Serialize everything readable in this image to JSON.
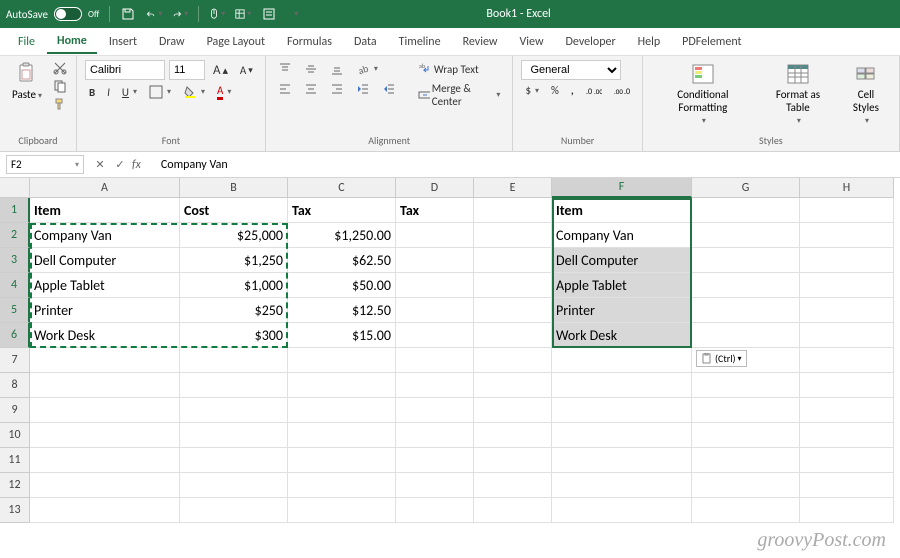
{
  "titlebar": {
    "autosave": "AutoSave",
    "autosave_state": "Off",
    "title": "Book1 - Excel"
  },
  "menu": {
    "file": "File",
    "home": "Home",
    "insert": "Insert",
    "draw": "Draw",
    "page_layout": "Page Layout",
    "formulas": "Formulas",
    "data": "Data",
    "timeline": "Timeline",
    "review": "Review",
    "view": "View",
    "developer": "Developer",
    "help": "Help",
    "pdf": "PDFelement"
  },
  "ribbon": {
    "clipboard": {
      "paste": "Paste",
      "label": "Clipboard"
    },
    "font": {
      "name": "Calibri",
      "size": "11",
      "label": "Font"
    },
    "alignment": {
      "wrap": "Wrap Text",
      "merge": "Merge & Center",
      "label": "Alignment"
    },
    "number": {
      "format": "General",
      "label": "Number"
    },
    "styles": {
      "cond": "Conditional Formatting",
      "table": "Format as Table",
      "cell": "Cell Styles",
      "label": "Styles"
    }
  },
  "formulabar": {
    "ref": "F2",
    "value": "Company Van"
  },
  "columns": [
    "A",
    "B",
    "C",
    "D",
    "E",
    "F",
    "G",
    "H"
  ],
  "grid": {
    "headers": {
      "A": "Item",
      "B": "Cost",
      "C": "Tax",
      "D": "Tax",
      "F": "Item"
    },
    "rows": [
      {
        "A": "Company Van",
        "B": "$25,000",
        "C": "$1,250.00",
        "F": "Company Van"
      },
      {
        "A": "Dell Computer",
        "B": "$1,250",
        "C": "$62.50",
        "F": "Dell Computer"
      },
      {
        "A": "Apple Tablet",
        "B": "$1,000",
        "C": "$50.00",
        "F": "Apple Tablet"
      },
      {
        "A": "Printer",
        "B": "$250",
        "C": "$12.50",
        "F": "Printer"
      },
      {
        "A": "Work Desk",
        "B": "$300",
        "C": "$15.00",
        "F": "Work Desk"
      }
    ]
  },
  "paste_options": "(Ctrl)",
  "watermark": "groovyPost.com"
}
